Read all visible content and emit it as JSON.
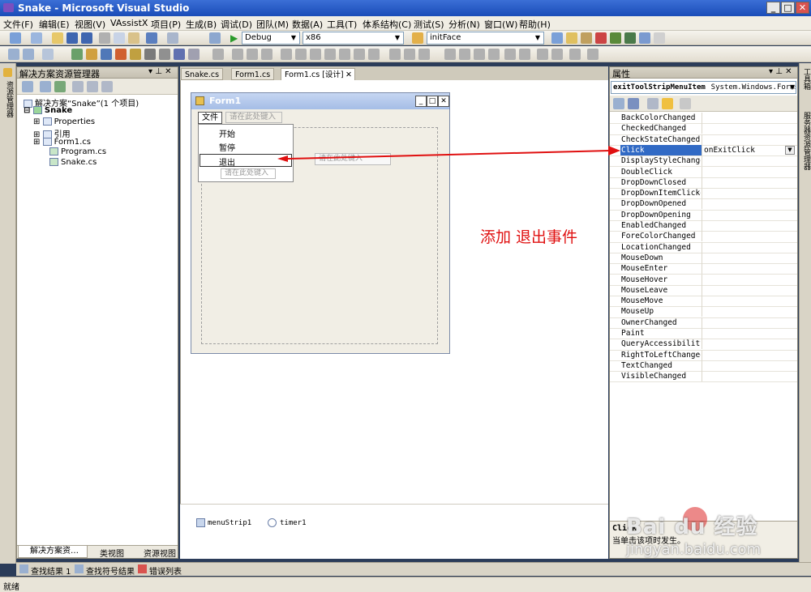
{
  "window": {
    "title": "Snake - Microsoft Visual Studio",
    "minimize": "_",
    "maximize": "□",
    "close": "✕"
  },
  "menu": [
    "文件(F)",
    "编辑(E)",
    "视图(V)",
    "VAssistX",
    "项目(P)",
    "生成(B)",
    "调试(D)",
    "团队(M)",
    "数据(A)",
    "工具(T)",
    "体系结构(C)",
    "测试(S)",
    "分析(N)",
    "窗口(W)",
    "帮助(H)"
  ],
  "toolbar": {
    "config": "Debug",
    "platform": "x86",
    "find": "initFace"
  },
  "solution_explorer": {
    "title": "解决方案资源管理器",
    "pin": "▾ ⊥ ✕",
    "root": "解决方案“Snake”(1 个项目)",
    "project": "Snake",
    "items": [
      "Properties",
      "引用",
      "Form1.cs",
      "Program.cs",
      "Snake.cs"
    ],
    "bottom_tabs": [
      "解决方案资…",
      "类视图",
      "资源视图"
    ]
  },
  "left_strip": "资源管理器",
  "doc_tabs": [
    "Snake.cs",
    "Form1.cs",
    "Form1.cs [设计]"
  ],
  "form": {
    "title": "Form1",
    "menu_top": "文件",
    "type_here": "请在此处键入",
    "items": [
      "开始",
      "暂停",
      "退出"
    ],
    "components": [
      "menuStrip1",
      "timer1"
    ]
  },
  "annotation": "添加 退出事件",
  "properties": {
    "title": "属性",
    "object": "exitToolStripMenuItem",
    "object_type": "System.Windows.Forms.",
    "rows": [
      "BackColorChanged",
      "CheckedChanged",
      "CheckStateChanged",
      "Click",
      "DisplayStyleChanged",
      "DoubleClick",
      "DropDownClosed",
      "DropDownItemClicked",
      "DropDownOpened",
      "DropDownOpening",
      "EnabledChanged",
      "ForeColorChanged",
      "LocationChanged",
      "MouseDown",
      "MouseEnter",
      "MouseHover",
      "MouseLeave",
      "MouseMove",
      "MouseUp",
      "OwnerChanged",
      "Paint",
      "QueryAccessibilityHel",
      "RightToLeftChanged",
      "TextChanged",
      "VisibleChanged"
    ],
    "click_value": "onExitClick",
    "desc_title": "Click",
    "desc_text": "当单击该项时发生。"
  },
  "right_strip": [
    "工具箱",
    "服务器资源管理器"
  ],
  "output_tabs": [
    "查找结果 1",
    "查找符号结果",
    "错误列表"
  ],
  "status": "就绪",
  "watermark": {
    "brand": "Bai du 经验",
    "url": "jingyan.baidu.com"
  },
  "colors": {
    "accent": "#316ac5",
    "annotation": "#e01010"
  }
}
